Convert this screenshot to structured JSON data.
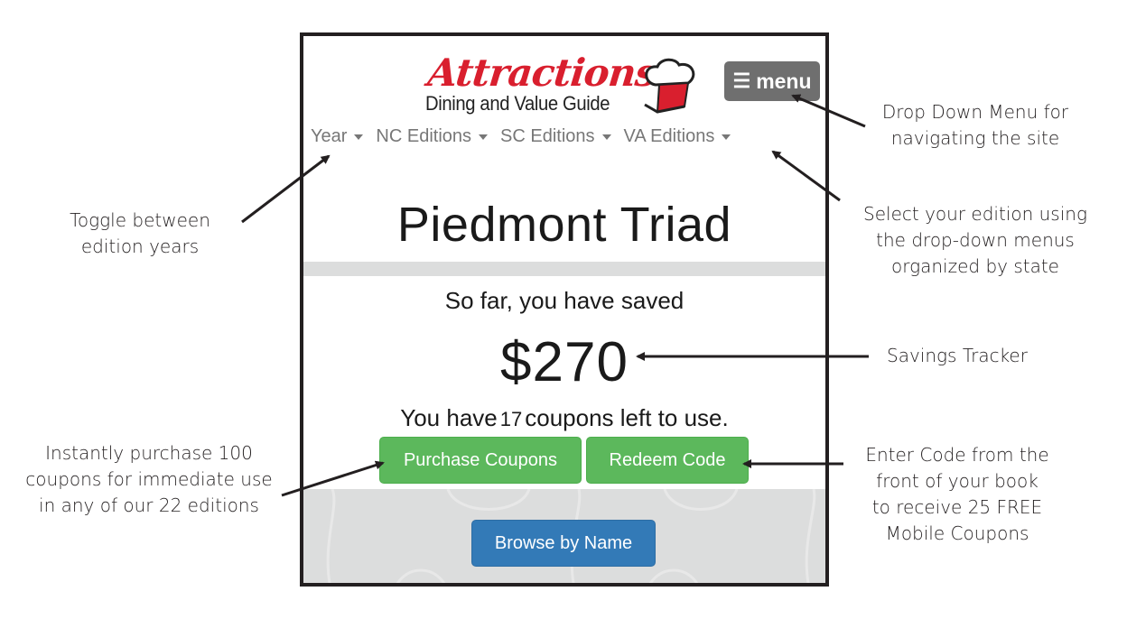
{
  "app": {
    "logo": {
      "title": "Attractions",
      "subtitle": "Dining and Value Guide"
    },
    "menu_button": {
      "icon": "hamburger-icon",
      "label": "menu"
    },
    "nav": [
      {
        "label": "Year",
        "icon": "caret-down-icon"
      },
      {
        "label": "NC Editions",
        "icon": "caret-down-icon"
      },
      {
        "label": "SC Editions",
        "icon": "caret-down-icon"
      },
      {
        "label": "VA Editions",
        "icon": "caret-down-icon"
      }
    ],
    "edition_title": "Piedmont Triad",
    "savings": {
      "label": "So far, you have saved",
      "amount": "$270"
    },
    "coupons": {
      "prefix": "You have",
      "count": "17",
      "suffix": "coupons left to use."
    },
    "buttons": {
      "purchase": "Purchase Coupons",
      "redeem": "Redeem Code",
      "browse": "Browse by Name"
    },
    "colors": {
      "brand_red": "#d91f2e",
      "success_green": "#5cb85c",
      "primary_blue": "#337ab7",
      "menu_gray": "#6f6f6f"
    }
  },
  "annotations": {
    "menu": [
      "Drop Down Menu for",
      "navigating the site"
    ],
    "editions": [
      "Select your edition using",
      "the drop-down menus",
      "organized by state"
    ],
    "year": [
      "Toggle between",
      "edition years"
    ],
    "savings": [
      "Savings Tracker"
    ],
    "purchase": [
      "Instantly purchase 100",
      "coupons for immediate use",
      "in any of our 22 editions"
    ],
    "redeem": [
      "Enter Code  from the",
      "front of your book",
      "to receive 25 FREE",
      "Mobile Coupons"
    ]
  }
}
